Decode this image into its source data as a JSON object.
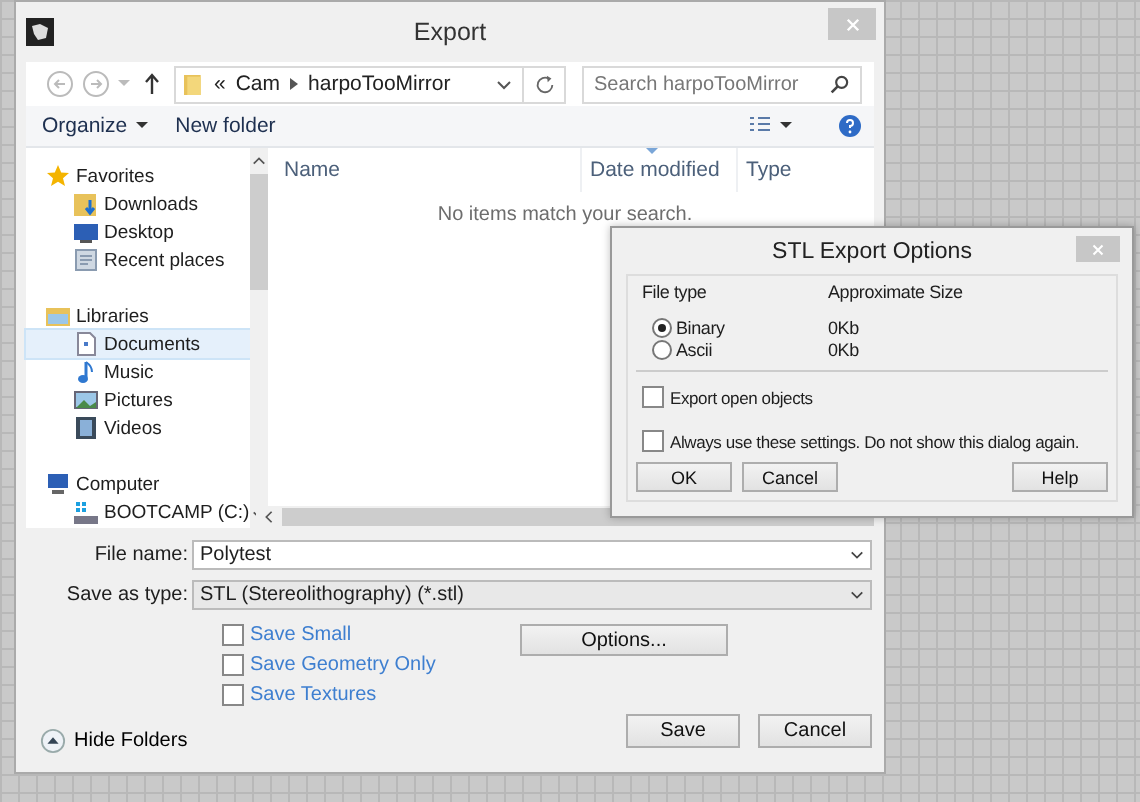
{
  "export_dialog": {
    "title": "Export",
    "nav": {
      "overflow": "«",
      "path": [
        "Cam",
        "harpoTooMirror"
      ],
      "search_placeholder": "Search harpoTooMirror"
    },
    "toolbar": {
      "organize": "Organize",
      "new_folder": "New folder"
    },
    "sidebar": {
      "groups": [
        {
          "label": "Favorites",
          "kind": "star",
          "selected": false,
          "items": [
            {
              "label": "Downloads",
              "kind": "downloads",
              "selected": false
            },
            {
              "label": "Desktop",
              "kind": "desktop",
              "selected": false
            },
            {
              "label": "Recent places",
              "kind": "recent",
              "selected": false
            }
          ]
        },
        {
          "label": "Libraries",
          "kind": "library",
          "selected": false,
          "items": [
            {
              "label": "Documents",
              "kind": "document",
              "selected": true
            },
            {
              "label": "Music",
              "kind": "music",
              "selected": false
            },
            {
              "label": "Pictures",
              "kind": "pictures",
              "selected": false
            },
            {
              "label": "Videos",
              "kind": "videos",
              "selected": false
            }
          ]
        },
        {
          "label": "Computer",
          "kind": "computer",
          "selected": false,
          "items": [
            {
              "label": "BOOTCAMP (C:)",
              "kind": "drive",
              "selected": false
            }
          ]
        }
      ]
    },
    "columns": [
      {
        "label": "Name",
        "sorted": false
      },
      {
        "label": "Date modified",
        "sorted": true
      },
      {
        "label": "Type",
        "sorted": false
      }
    ],
    "empty_message": "No items match your search.",
    "file_name": {
      "label": "File name:",
      "value": "Polytest"
    },
    "save_as_type": {
      "label": "Save as type:",
      "value": "STL (Stereolithography) (*.stl)"
    },
    "options": [
      {
        "label": "Save Small",
        "checked": false
      },
      {
        "label": "Save Geometry Only",
        "checked": false
      },
      {
        "label": "Save Textures",
        "checked": false
      }
    ],
    "options_button": "Options...",
    "hide_folders": "Hide Folders",
    "buttons": [
      "Save",
      "Cancel"
    ]
  },
  "stl_options": {
    "title": "STL Export Options",
    "headers": [
      "File type",
      "Approximate Size"
    ],
    "file_types": [
      {
        "label": "Binary",
        "size": "0Kb",
        "selected": true
      },
      {
        "label": "Ascii",
        "size": "0Kb",
        "selected": false
      }
    ],
    "checkboxes": [
      {
        "label": "Export open objects",
        "checked": false
      },
      {
        "label": "Always use these settings. Do not show this dialog again.",
        "checked": false
      }
    ],
    "buttons": [
      "OK",
      "Cancel",
      "Help"
    ]
  }
}
